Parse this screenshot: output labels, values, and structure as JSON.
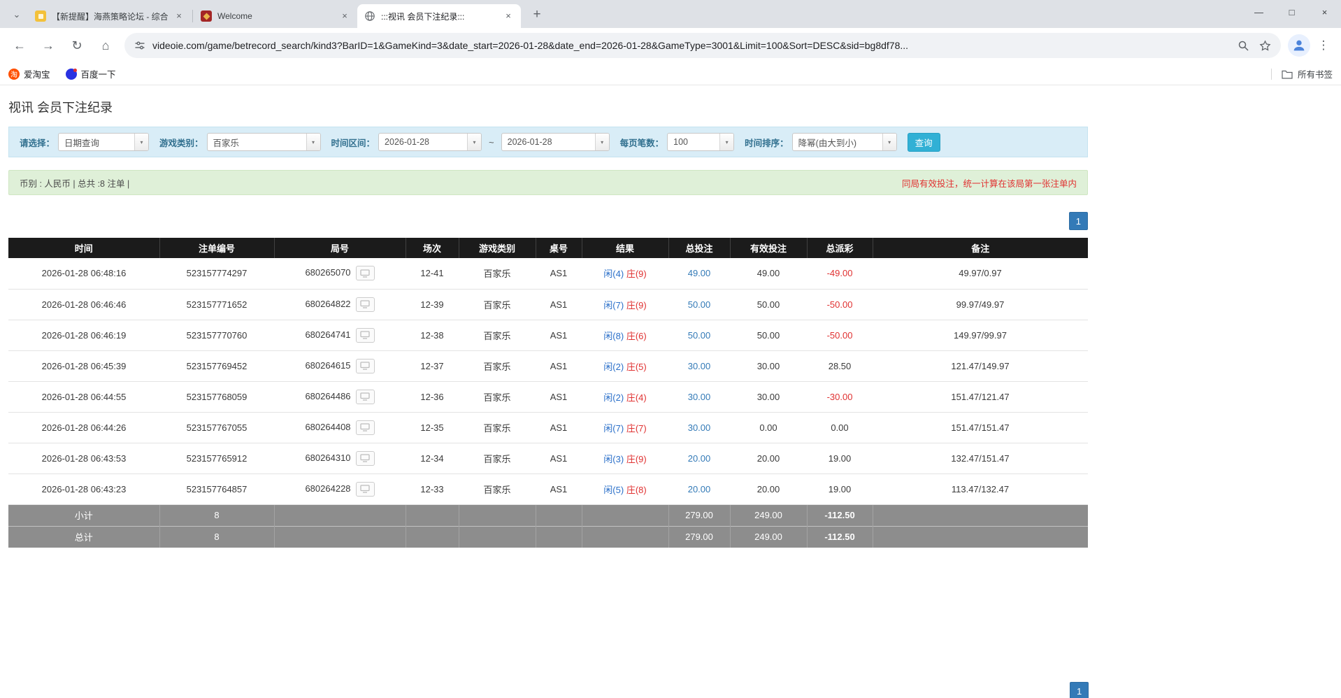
{
  "icons": {
    "tab_chevron": "⌄",
    "close": "×",
    "new_tab": "+",
    "minimize": "—",
    "maximize": "□",
    "window_close": "×",
    "back": "←",
    "forward": "→",
    "refresh": "↻",
    "home": "⌂",
    "menu": "⋮",
    "caret": "▾",
    "taobao_glyph": "淘"
  },
  "colors": {
    "link_blue": "#337ab7",
    "player_blue": "#2a6fc9",
    "banker_red": "#e03131",
    "negative_red": "#e03131",
    "search_button_bg": "#31b0d5",
    "pagination_bg": "#337ab7",
    "filter_bar_bg": "#d9edf7",
    "info_bar_bg": "#dff0d8",
    "table_header_bg": "#1b1b1b",
    "table_footer_bg": "#8d8d8d"
  },
  "browser": {
    "tabs": {
      "forum": "【新提醒】海燕策略论坛 - 综合...",
      "welcome": "Welcome",
      "active": ":::视讯 会员下注纪录:::"
    },
    "url": "videoie.com/game/betrecord_search/kind3?BarID=1&GameKind=3&date_start=2026-01-28&date_end=2026-01-28&GameType=3001&Limit=100&Sort=DESC&sid=bg8df78...",
    "bookmarks": {
      "taobao": "爱淘宝",
      "baidu": "百度一下",
      "all_bookmarks": "所有书签"
    }
  },
  "page": {
    "title": "视讯 会员下注纪录",
    "filters": {
      "select_label": "请选择：",
      "select_value": "日期查询",
      "game_label": "游戏类别：",
      "game_value": "百家乐",
      "range_label": "时间区间：",
      "date_start": "2026-01-28",
      "range_separator": "~",
      "date_end": "2026-01-28",
      "per_page_label": "每页笔数：",
      "per_page_value": "100",
      "sort_label": "时间排序：",
      "sort_value": "降幂(由大到小)",
      "search_label": "查询"
    },
    "info": {
      "summary": "币别 : 人民币 | 总共 :8 注单 |",
      "notice": "同局有效投注，统一计算在该局第一张注单内"
    },
    "pagination": {
      "current": "1"
    },
    "table": {
      "headers": [
        "时间",
        "注单编号",
        "局号",
        "场次",
        "游戏类别",
        "桌号",
        "结果",
        "总投注",
        "有效投注",
        "总派彩",
        "备注"
      ],
      "rows": [
        {
          "time": "2026-01-28 06:48:16",
          "bet_no": "523157774297",
          "round_no": "680265070",
          "session": "12-41",
          "game": "百家乐",
          "table_no": "AS1",
          "result_player": "闲(4)",
          "result_banker": "庄(9)",
          "total_bet": "49.00",
          "valid_bet": "49.00",
          "payout": "-49.00",
          "remark": "49.97/0.97"
        },
        {
          "time": "2026-01-28 06:46:46",
          "bet_no": "523157771652",
          "round_no": "680264822",
          "session": "12-39",
          "game": "百家乐",
          "table_no": "AS1",
          "result_player": "闲(7)",
          "result_banker": "庄(9)",
          "total_bet": "50.00",
          "valid_bet": "50.00",
          "payout": "-50.00",
          "remark": "99.97/49.97"
        },
        {
          "time": "2026-01-28 06:46:19",
          "bet_no": "523157770760",
          "round_no": "680264741",
          "session": "12-38",
          "game": "百家乐",
          "table_no": "AS1",
          "result_player": "闲(8)",
          "result_banker": "庄(6)",
          "total_bet": "50.00",
          "valid_bet": "50.00",
          "payout": "-50.00",
          "remark": "149.97/99.97"
        },
        {
          "time": "2026-01-28 06:45:39",
          "bet_no": "523157769452",
          "round_no": "680264615",
          "session": "12-37",
          "game": "百家乐",
          "table_no": "AS1",
          "result_player": "闲(2)",
          "result_banker": "庄(5)",
          "total_bet": "30.00",
          "valid_bet": "30.00",
          "payout": "28.50",
          "remark": "121.47/149.97"
        },
        {
          "time": "2026-01-28 06:44:55",
          "bet_no": "523157768059",
          "round_no": "680264486",
          "session": "12-36",
          "game": "百家乐",
          "table_no": "AS1",
          "result_player": "闲(2)",
          "result_banker": "庄(4)",
          "total_bet": "30.00",
          "valid_bet": "30.00",
          "payout": "-30.00",
          "remark": "151.47/121.47"
        },
        {
          "time": "2026-01-28 06:44:26",
          "bet_no": "523157767055",
          "round_no": "680264408",
          "session": "12-35",
          "game": "百家乐",
          "table_no": "AS1",
          "result_player": "闲(7)",
          "result_banker": "庄(7)",
          "total_bet": "30.00",
          "valid_bet": "0.00",
          "payout": "0.00",
          "remark": "151.47/151.47"
        },
        {
          "time": "2026-01-28 06:43:53",
          "bet_no": "523157765912",
          "round_no": "680264310",
          "session": "12-34",
          "game": "百家乐",
          "table_no": "AS1",
          "result_player": "闲(3)",
          "result_banker": "庄(9)",
          "total_bet": "20.00",
          "valid_bet": "20.00",
          "payout": "19.00",
          "remark": "132.47/151.47"
        },
        {
          "time": "2026-01-28 06:43:23",
          "bet_no": "523157764857",
          "round_no": "680264228",
          "session": "12-33",
          "game": "百家乐",
          "table_no": "AS1",
          "result_player": "闲(5)",
          "result_banker": "庄(8)",
          "total_bet": "20.00",
          "valid_bet": "20.00",
          "payout": "19.00",
          "remark": "113.47/132.47"
        }
      ],
      "subtotal": {
        "label": "小计",
        "count": "8",
        "total_bet": "279.00",
        "valid_bet": "249.00",
        "payout": "-112.50"
      },
      "total": {
        "label": "总计",
        "count": "8",
        "total_bet": "279.00",
        "valid_bet": "249.00",
        "payout": "-112.50"
      }
    }
  }
}
